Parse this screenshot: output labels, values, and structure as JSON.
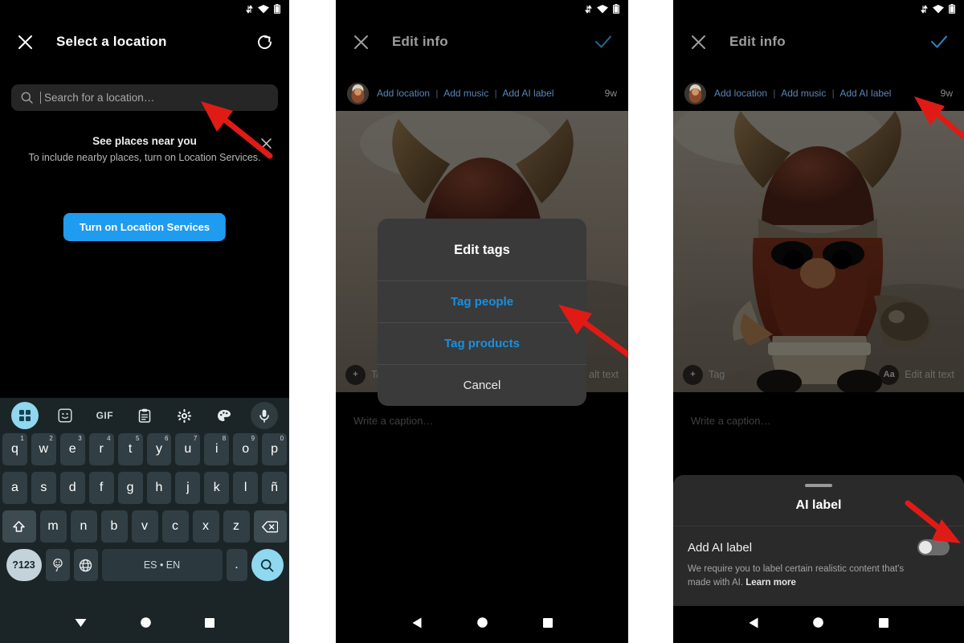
{
  "panels": [
    {
      "id": "select-location",
      "statusbar": {
        "icons": [
          "sync-arrows-icon",
          "wifi-icon",
          "battery-icon"
        ]
      },
      "header": {
        "title": "Select a location",
        "close_icon": "close-icon",
        "refresh_icon": "refresh-icon"
      },
      "search": {
        "placeholder": "Search for a location…",
        "value": "",
        "icon": "search-icon"
      },
      "nearby": {
        "title": "See places near you",
        "subtitle": "To include nearby places, turn on Location Services.",
        "dismiss_icon": "close-icon",
        "button_label": "Turn on Location Services",
        "button_color": "#1f9bf0"
      },
      "keyboard": {
        "toolbar": [
          "apps-grid-icon",
          "sticker-icon",
          "gif-icon",
          "clipboard-icon",
          "settings-gear-icon",
          "palette-icon",
          "microphone-icon"
        ],
        "row1": [
          {
            "key": "q",
            "sup": "1"
          },
          {
            "key": "w",
            "sup": "2"
          },
          {
            "key": "e",
            "sup": "3"
          },
          {
            "key": "r",
            "sup": "4"
          },
          {
            "key": "t",
            "sup": "5"
          },
          {
            "key": "y",
            "sup": "6"
          },
          {
            "key": "u",
            "sup": "7"
          },
          {
            "key": "i",
            "sup": "8"
          },
          {
            "key": "o",
            "sup": "9"
          },
          {
            "key": "p",
            "sup": "0"
          }
        ],
        "row2": [
          "a",
          "s",
          "d",
          "f",
          "g",
          "h",
          "j",
          "k",
          "l",
          "ñ"
        ],
        "row3": [
          "z",
          "x",
          "c",
          "v",
          "b",
          "n",
          "m"
        ],
        "shift_icon": "shift-up-icon",
        "backspace_icon": "backspace-icon",
        "symbols_label": "?123",
        "emoji_label": "☺",
        "globe_icon": "language-globe-icon",
        "space_label": "ES • EN",
        "period_label": ".",
        "action_icon": "search-icon"
      },
      "navbar": {
        "back_icon": "keyboard-hide-down-icon",
        "home_icon": "home-circle-icon",
        "recents_icon": "recents-square-icon"
      }
    },
    {
      "id": "edit-info-tags",
      "statusbar": {
        "icons": [
          "sync-arrows-icon",
          "wifi-icon",
          "battery-icon"
        ]
      },
      "header": {
        "title": "Edit info",
        "close_icon": "close-icon",
        "confirm_icon": "check-icon"
      },
      "meta": {
        "avatar": "user-avatar",
        "links": [
          "Add location",
          "Add music",
          "Add AI label"
        ],
        "separator": "|",
        "age": "9w"
      },
      "photo": {
        "alt": "Viking gnome figurine with horned helmet, red beard and shield"
      },
      "photo_overlay": {
        "tag_icon": "plus-icon",
        "tag_label": "Tag",
        "alt_icon": "Aa",
        "alt_label": "Edit alt text"
      },
      "caption": {
        "placeholder": "Write a caption…"
      },
      "dialog": {
        "title": "Edit tags",
        "items": [
          {
            "label": "Tag people",
            "style": "accent"
          },
          {
            "label": "Tag products",
            "style": "accent"
          },
          {
            "label": "Cancel",
            "style": "plain"
          }
        ],
        "accent_color": "#1a8fe0"
      },
      "navbar": {
        "back_icon": "back-triangle-icon",
        "home_icon": "home-circle-icon",
        "recents_icon": "recents-square-icon"
      }
    },
    {
      "id": "edit-info-ai-label",
      "statusbar": {
        "icons": [
          "sync-arrows-icon",
          "wifi-icon",
          "battery-icon"
        ]
      },
      "header": {
        "title": "Edit info",
        "close_icon": "close-icon",
        "confirm_icon": "check-icon"
      },
      "meta": {
        "avatar": "user-avatar",
        "links": [
          "Add location",
          "Add music",
          "Add AI label"
        ],
        "separator": "|",
        "age": "9w"
      },
      "photo": {
        "alt": "Viking gnome figurine with horned helmet, red beard and shield"
      },
      "photo_overlay": {
        "tag_icon": "plus-icon",
        "tag_label": "Tag",
        "alt_icon": "Aa",
        "alt_label": "Edit alt text"
      },
      "caption": {
        "placeholder": "Write a caption…"
      },
      "sheet": {
        "handle": "drag-handle",
        "title": "AI label",
        "row_label": "Add AI label",
        "toggle_state": "off",
        "description": "We require you to label certain realistic content that's made with AI. ",
        "learn_more": "Learn more"
      },
      "navbar": {
        "back_icon": "back-triangle-icon",
        "home_icon": "home-circle-icon",
        "recents_icon": "recents-square-icon"
      }
    }
  ],
  "annotations": {
    "arrow_color": "#e01b15",
    "arrows": [
      {
        "name": "arrow-to-search-field",
        "panel": "select-location"
      },
      {
        "name": "arrow-to-tag-people",
        "panel": "edit-info-tags"
      },
      {
        "name": "arrow-to-add-ai-label",
        "panel": "edit-info-ai-label"
      },
      {
        "name": "arrow-to-ai-label-toggle",
        "panel": "edit-info-ai-label"
      }
    ]
  }
}
